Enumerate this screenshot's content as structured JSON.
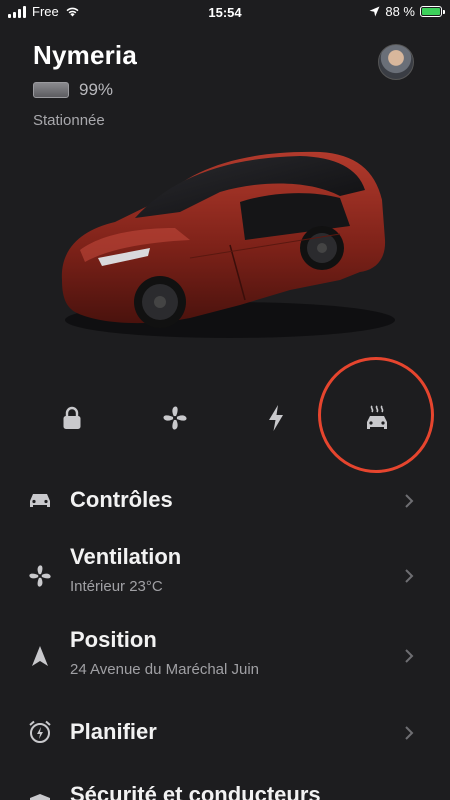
{
  "status_bar": {
    "carrier": "Free",
    "time": "15:54",
    "battery_percent": "88 %",
    "battery_color": "#3dd15b"
  },
  "vehicle": {
    "name": "Nymeria",
    "battery": "99%",
    "status": "Stationnée",
    "paint_color": "#8e2a1f"
  },
  "quick_actions": [
    {
      "icon": "lock-icon"
    },
    {
      "icon": "fan-icon"
    },
    {
      "icon": "bolt-icon"
    },
    {
      "icon": "car-heat-icon",
      "highlighted": true
    }
  ],
  "highlight_color": "#e6452e",
  "menu": [
    {
      "icon": "car-icon",
      "title": "Contrôles",
      "subtitle": ""
    },
    {
      "icon": "fan-icon",
      "title": "Ventilation",
      "subtitle": "Intérieur 23°C"
    },
    {
      "icon": "location-arrow-icon",
      "title": "Position",
      "subtitle": "24 Avenue du Maréchal Juin"
    },
    {
      "icon": "alarm-clock-icon",
      "title": "Planifier",
      "subtitle": ""
    },
    {
      "icon": "shield-icon",
      "title": "Sécurité et conducteurs",
      "subtitle": ""
    }
  ]
}
